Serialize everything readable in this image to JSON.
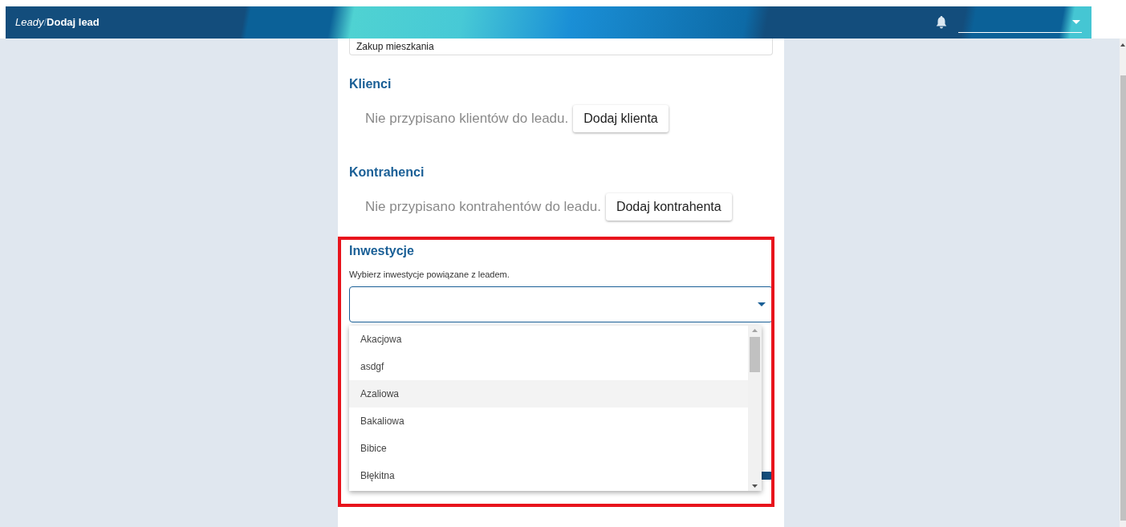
{
  "header": {
    "breadcrumb": [
      {
        "label": "Leady",
        "selected": false
      },
      {
        "label": "Dodaj lead",
        "selected": true
      }
    ],
    "separator": "/"
  },
  "form": {
    "title_field": {
      "value": "Zakup mieszkania"
    },
    "sections": [
      {
        "kind": "empty",
        "title": "Klienci",
        "message": "Nie przypisano klientów do leadu.",
        "button": "Dodaj klienta",
        "highlighted": false
      },
      {
        "kind": "empty",
        "title": "Kontrahenci",
        "message": "Nie przypisano kontrahentów do leadu.",
        "button": "Dodaj kontrahenta",
        "highlighted": false
      },
      {
        "kind": "select",
        "title": "Inwestycje",
        "hint": "Wybierz inwestycje powiązane z leadem.",
        "highlighted": true,
        "open": true,
        "options": [
          {
            "label": "Akacjowa",
            "hovered": false
          },
          {
            "label": "asdgf",
            "hovered": false
          },
          {
            "label": "Azaliowa",
            "hovered": true
          },
          {
            "label": "Bakaliowa",
            "hovered": false
          },
          {
            "label": "Bibice",
            "hovered": false
          },
          {
            "label": "Błękitna",
            "hovered": false
          }
        ]
      }
    ]
  }
}
